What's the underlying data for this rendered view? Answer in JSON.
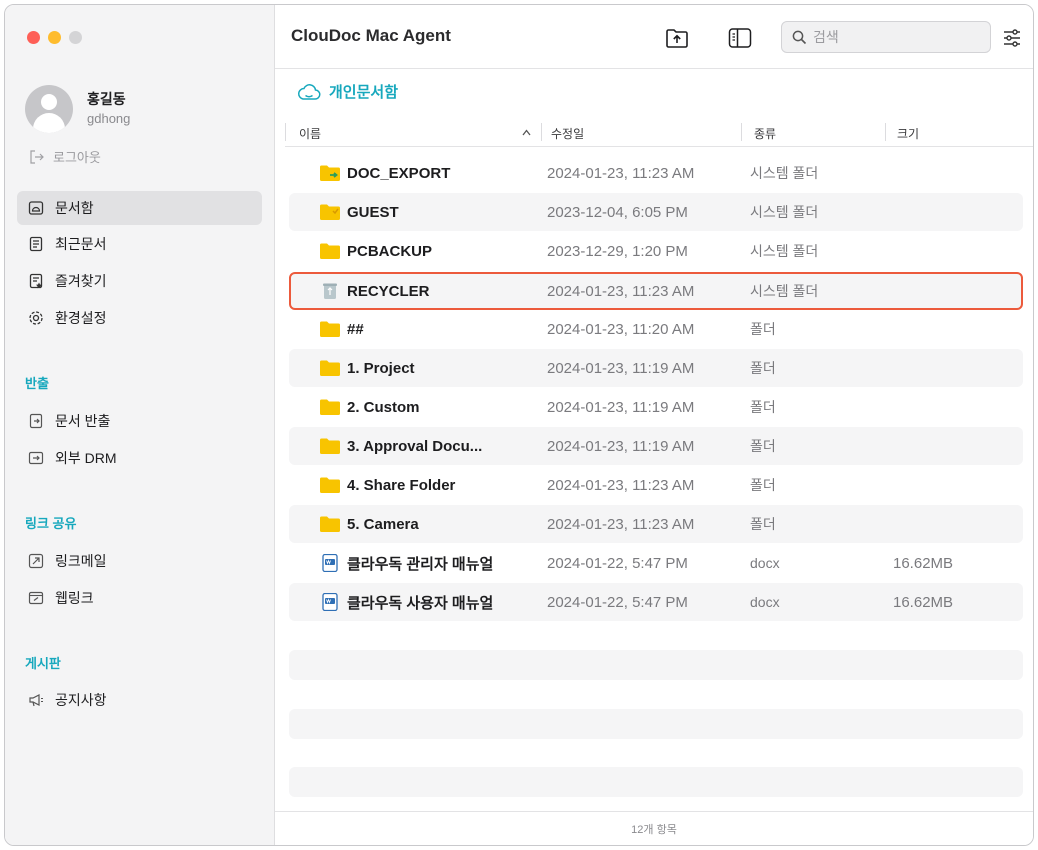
{
  "profile": {
    "name": "홍길동",
    "id": "gdhong",
    "logout": "로그아웃"
  },
  "sidebar": {
    "items": [
      {
        "label": "문서함",
        "icon": "document-box-icon"
      },
      {
        "label": "최근문서",
        "icon": "recent-document-icon"
      },
      {
        "label": "즐겨찾기",
        "icon": "favorite-document-icon"
      },
      {
        "label": "환경설정",
        "icon": "gear-icon"
      }
    ],
    "sections": [
      {
        "title": "반출",
        "items": [
          {
            "label": "문서 반출",
            "icon": "export-icon"
          },
          {
            "label": "외부 DRM",
            "icon": "external-drm-icon"
          }
        ]
      },
      {
        "title": "링크 공유",
        "items": [
          {
            "label": "링크메일",
            "icon": "link-mail-icon"
          },
          {
            "label": "웹링크",
            "icon": "web-link-icon"
          }
        ]
      },
      {
        "title": "게시판",
        "items": [
          {
            "label": "공지사항",
            "icon": "megaphone-icon"
          }
        ]
      }
    ]
  },
  "toolbar": {
    "title": "ClouDoc Mac Agent",
    "search_placeholder": "검색"
  },
  "breadcrumb": {
    "label": "개인문서함"
  },
  "columns": {
    "name": "이름",
    "modified": "수정일",
    "type": "종류",
    "size": "크기"
  },
  "files": [
    {
      "name": "DOC_EXPORT",
      "date": "2024-01-23, 11:23 AM",
      "type": "시스템 폴더",
      "size": "",
      "icon": "export-folder-icon"
    },
    {
      "name": "GUEST",
      "date": "2023-12-04, 6:05 PM",
      "type": "시스템 폴더",
      "size": "",
      "icon": "guest-folder-icon"
    },
    {
      "name": "PCBACKUP",
      "date": "2023-12-29, 1:20 PM",
      "type": "시스템 폴더",
      "size": "",
      "icon": "folder-icon"
    },
    {
      "name": "RECYCLER",
      "date": "2024-01-23, 11:23 AM",
      "type": "시스템 폴더",
      "size": "",
      "icon": "trash-icon"
    },
    {
      "name": "##",
      "date": "2024-01-23, 11:20 AM",
      "type": "폴더",
      "size": "",
      "icon": "folder-icon"
    },
    {
      "name": "1. Project",
      "date": "2024-01-23, 11:19 AM",
      "type": "폴더",
      "size": "",
      "icon": "folder-icon"
    },
    {
      "name": "2. Custom",
      "date": "2024-01-23, 11:19 AM",
      "type": "폴더",
      "size": "",
      "icon": "folder-icon"
    },
    {
      "name": "3. Approval Docu...",
      "date": "2024-01-23, 11:19 AM",
      "type": "폴더",
      "size": "",
      "icon": "folder-icon"
    },
    {
      "name": "4. Share Folder",
      "date": "2024-01-23, 11:23 AM",
      "type": "폴더",
      "size": "",
      "icon": "folder-icon"
    },
    {
      "name": "5. Camera",
      "date": "2024-01-23, 11:23 AM",
      "type": "폴더",
      "size": "",
      "icon": "folder-icon"
    },
    {
      "name": "클라우독 관리자 매뉴얼",
      "date": "2024-01-22, 5:47 PM",
      "type": "docx",
      "size": "16.62MB",
      "icon": "docx-file-icon"
    },
    {
      "name": "클라우독 사용자 매뉴얼",
      "date": "2024-01-22, 5:47 PM",
      "type": "docx",
      "size": "16.62MB",
      "icon": "docx-file-icon"
    }
  ],
  "footer": {
    "count": "12개 항목"
  },
  "colors": {
    "accent": "#17a8bd",
    "selection_border": "#ec5a3c",
    "folder": "#f8c400"
  }
}
